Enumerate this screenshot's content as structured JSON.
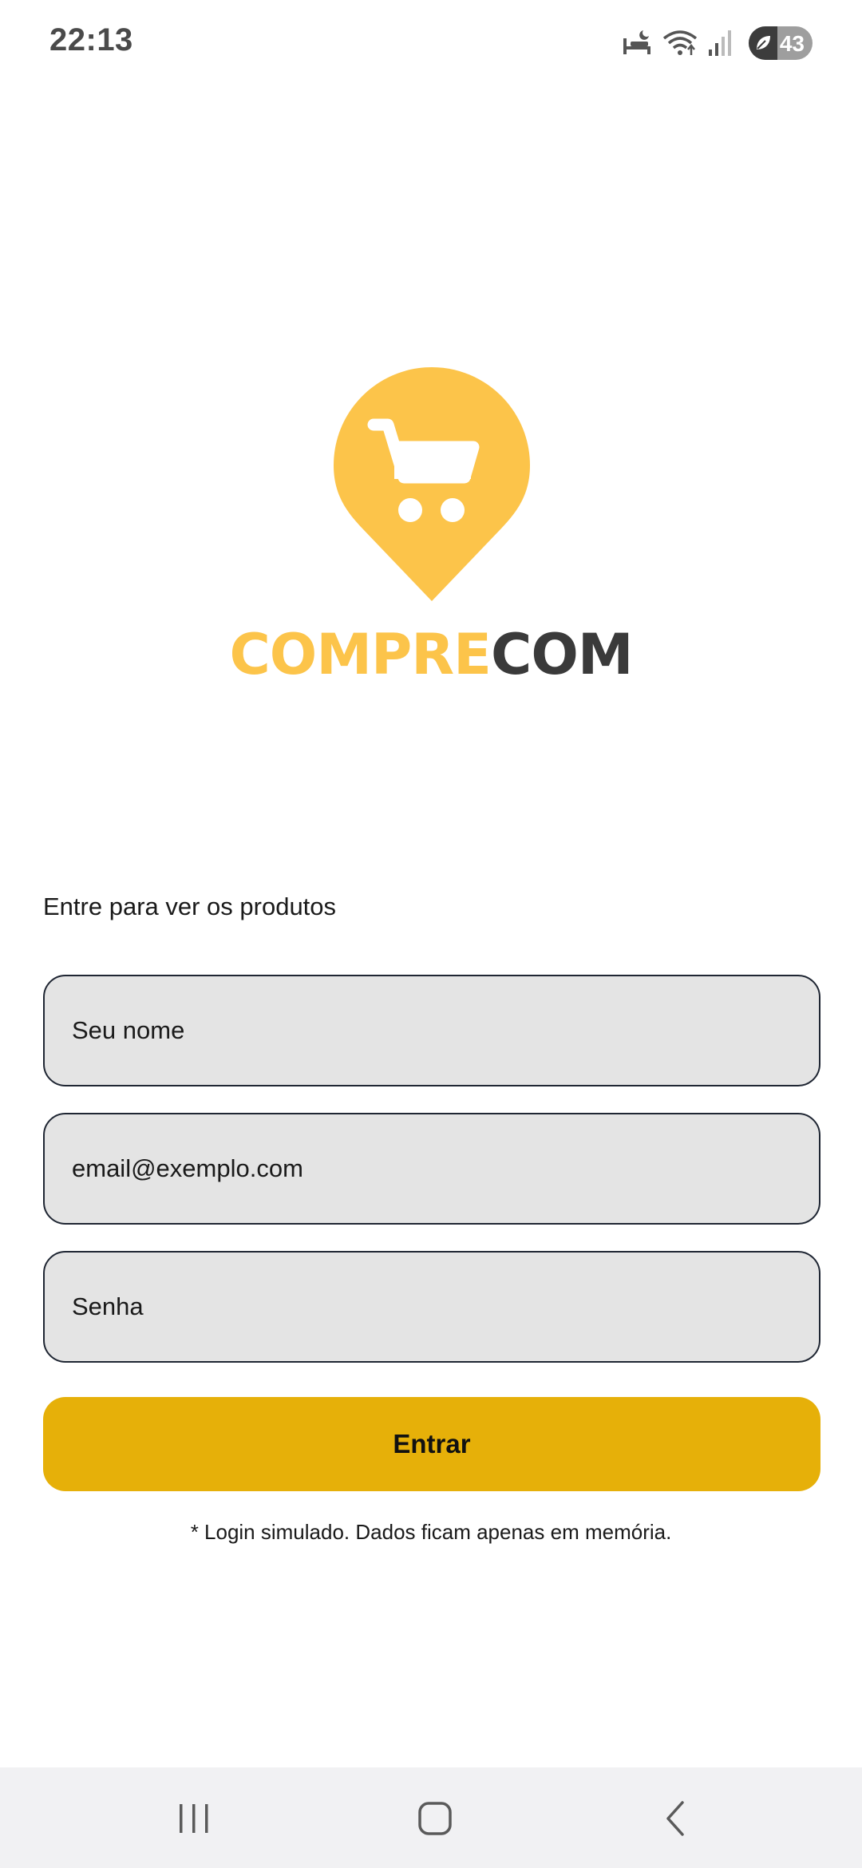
{
  "status_bar": {
    "time": "22:13",
    "battery_level": "43",
    "icons": [
      "sleep-mode-icon",
      "wifi-icon",
      "signal-icon",
      "battery-saver-icon"
    ]
  },
  "logo": {
    "icon": "shopping-cart-location-pin-icon",
    "word_a": "COMPRE",
    "word_b": "COM",
    "colors": {
      "primary": "#fcc44a",
      "secondary": "#3a3a3a"
    }
  },
  "login_form": {
    "heading": "Entre para ver os produtos",
    "name_placeholder": "Seu nome",
    "email_placeholder": "email@exemplo.com",
    "password_placeholder": "Senha",
    "submit_label": "Entrar",
    "footnote": "* Login simulado. Dados ficam apenas em memória.",
    "button_color": "#e6b009",
    "input_background": "#e4e4e4"
  },
  "nav_bar": {
    "buttons": [
      "recents-icon",
      "home-icon",
      "back-icon"
    ]
  }
}
